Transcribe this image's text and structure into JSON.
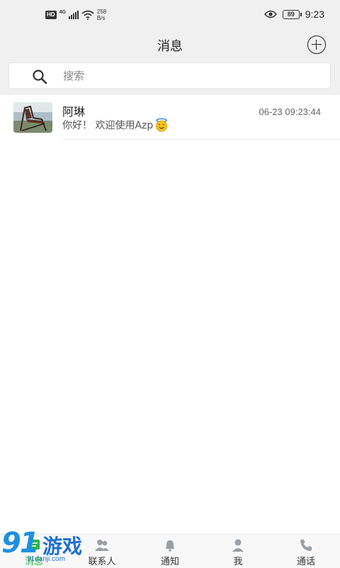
{
  "status_bar": {
    "hd": "HD",
    "network": "4G",
    "speed_value": "258",
    "speed_unit": "B/s",
    "battery": "89",
    "time": "9:23"
  },
  "header": {
    "title": "消息",
    "add_icon": "plus-circle-icon"
  },
  "search": {
    "placeholder": "搜索",
    "icon": "search-icon"
  },
  "conversations": [
    {
      "name": "阿琳",
      "preview": "你好！ 欢迎使用Azp",
      "emoji": "smiling-face-with-halo",
      "time": "06-23 09:23:44"
    }
  ],
  "tabs": [
    {
      "label": "消息",
      "icon": "message-icon",
      "active": true
    },
    {
      "label": "联系人",
      "icon": "contacts-icon",
      "active": false
    },
    {
      "label": "通知",
      "icon": "bell-icon",
      "active": false
    },
    {
      "label": "我",
      "icon": "person-icon",
      "active": false
    },
    {
      "label": "通话",
      "icon": "phone-icon",
      "active": false
    }
  ],
  "watermark": {
    "number": "91",
    "text": "游戏",
    "url": "91danji.com"
  },
  "colors": {
    "accent": "#2db34a",
    "background": "#f0f0f0",
    "watermark": "#1e6fd0"
  }
}
